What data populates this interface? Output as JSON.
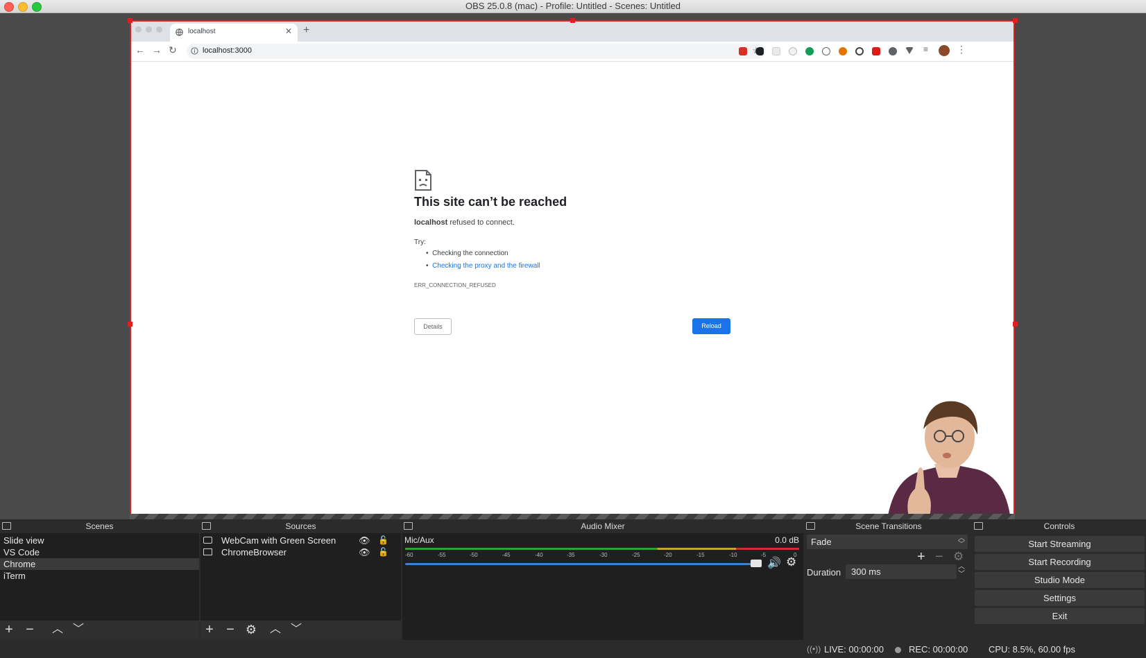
{
  "window": {
    "title": "OBS 25.0.8 (mac) - Profile: Untitled - Scenes: Untitled"
  },
  "browser": {
    "tab_title": "localhost",
    "url": "localhost:3000",
    "error": {
      "heading": "This site can’t be reached",
      "host": "localhost",
      "message": " refused to connect.",
      "try_label": "Try:",
      "suggestions": [
        "Checking the connection",
        "Checking the proxy and the firewall"
      ],
      "code": "ERR_CONNECTION_REFUSED",
      "details_button": "Details",
      "reload_button": "Reload"
    }
  },
  "panels": {
    "scenes": {
      "title": "Scenes",
      "items": [
        "Slide view",
        "VS Code",
        "Chrome",
        "iTerm"
      ],
      "selected": "Chrome"
    },
    "sources": {
      "title": "Sources",
      "items": [
        "WebCam with Green Screen",
        "ChromeBrowser"
      ]
    },
    "mixer": {
      "title": "Audio Mixer",
      "channel": "Mic/Aux",
      "level": "0.0 dB",
      "ticks": [
        "-60",
        "-55",
        "-50",
        "-45",
        "-40",
        "-35",
        "-30",
        "-25",
        "-20",
        "-15",
        "-10",
        "-5",
        "0"
      ],
      "volume": 1.0
    },
    "transitions": {
      "title": "Scene Transitions",
      "selected": "Fade",
      "duration_label": "Duration",
      "duration_value": "300 ms"
    },
    "controls": {
      "title": "Controls",
      "buttons": [
        "Start Streaming",
        "Start Recording",
        "Studio Mode",
        "Settings",
        "Exit"
      ]
    }
  },
  "status": {
    "live": "LIVE: 00:00:00",
    "rec": "REC: 00:00:00",
    "cpu": "CPU: 8.5%, 60.00 fps"
  },
  "colors": {
    "selection": "#e02020",
    "accent": "#1a73e8",
    "meter_green": "#2ca32c",
    "meter_yellow": "#c9a227",
    "meter_red": "#c8312c"
  }
}
